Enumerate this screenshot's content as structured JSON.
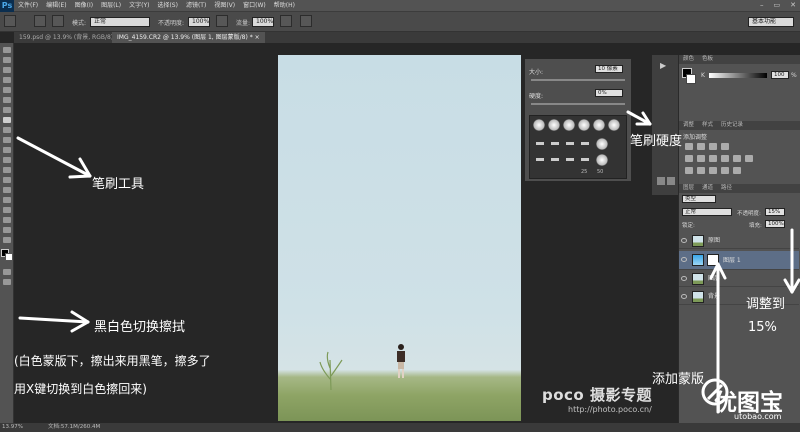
{
  "app": {
    "logo": "Ps"
  },
  "menu": [
    "文件(F)",
    "编辑(E)",
    "图像(I)",
    "图层(L)",
    "文字(Y)",
    "选择(S)",
    "滤镜(T)",
    "视图(V)",
    "窗口(W)",
    "帮助(H)"
  ],
  "options": {
    "mode_label": "模式:",
    "mode_value": "正常",
    "opacity_label": "不透明度:",
    "opacity_value": "100%",
    "flow_label": "流量:",
    "flow_value": "100%",
    "workspace": "基本功能"
  },
  "tabs": [
    {
      "label": "159.psd @ 13.9% (背景, RGB/8) ×"
    },
    {
      "label": "IMG_4159.CR2 @ 13.9% (图层 1, 图层蒙版/8) * ×"
    }
  ],
  "brush_panel": {
    "size_label": "大小:",
    "size_value": "10 像素",
    "hardness_label": "硬度:",
    "hardness_value": "0%",
    "tip_sizes": [
      "25",
      "50"
    ]
  },
  "color_panel": {
    "tabs": [
      "颜色",
      "色板"
    ],
    "k_label": "K",
    "k_value": "100",
    "unit": "%"
  },
  "adjust_panel": {
    "tabs": [
      "调整",
      "样式",
      "历史记录"
    ],
    "title": "添加调整"
  },
  "layers_panel": {
    "tabs": [
      "图层",
      "通道",
      "路径"
    ],
    "kind": "类型",
    "blend_mode": "正常",
    "opacity_label": "不透明度:",
    "opacity_value": "15%",
    "lock_label": "锁定:",
    "fill_label": "填充:",
    "fill_value": "100%",
    "layers": [
      {
        "name": "原图"
      },
      {
        "name": "图层 1"
      },
      {
        "name": "图层"
      },
      {
        "name": "背景"
      }
    ]
  },
  "status": {
    "zoom": "13.97%",
    "doc": "文档:57.1M/260.4M"
  },
  "watermark": {
    "brand": "poco 摄影专题",
    "url": "http://photo.poco.cn/"
  },
  "annotations": {
    "brush_tool": "笔刷工具",
    "brush_hardness": "笔刷硬度",
    "bw_switch": "黑白色切换擦拭",
    "note_line1": "(白色蒙版下，擦出来用黑笔，擦多了",
    "note_line2": "用X键切换到白色擦回来)",
    "adjust_to": "调整到",
    "adjust_value": "15%",
    "add_mask": "添加蒙版"
  },
  "site": {
    "name": "优图宝",
    "url": "utobao.com"
  }
}
